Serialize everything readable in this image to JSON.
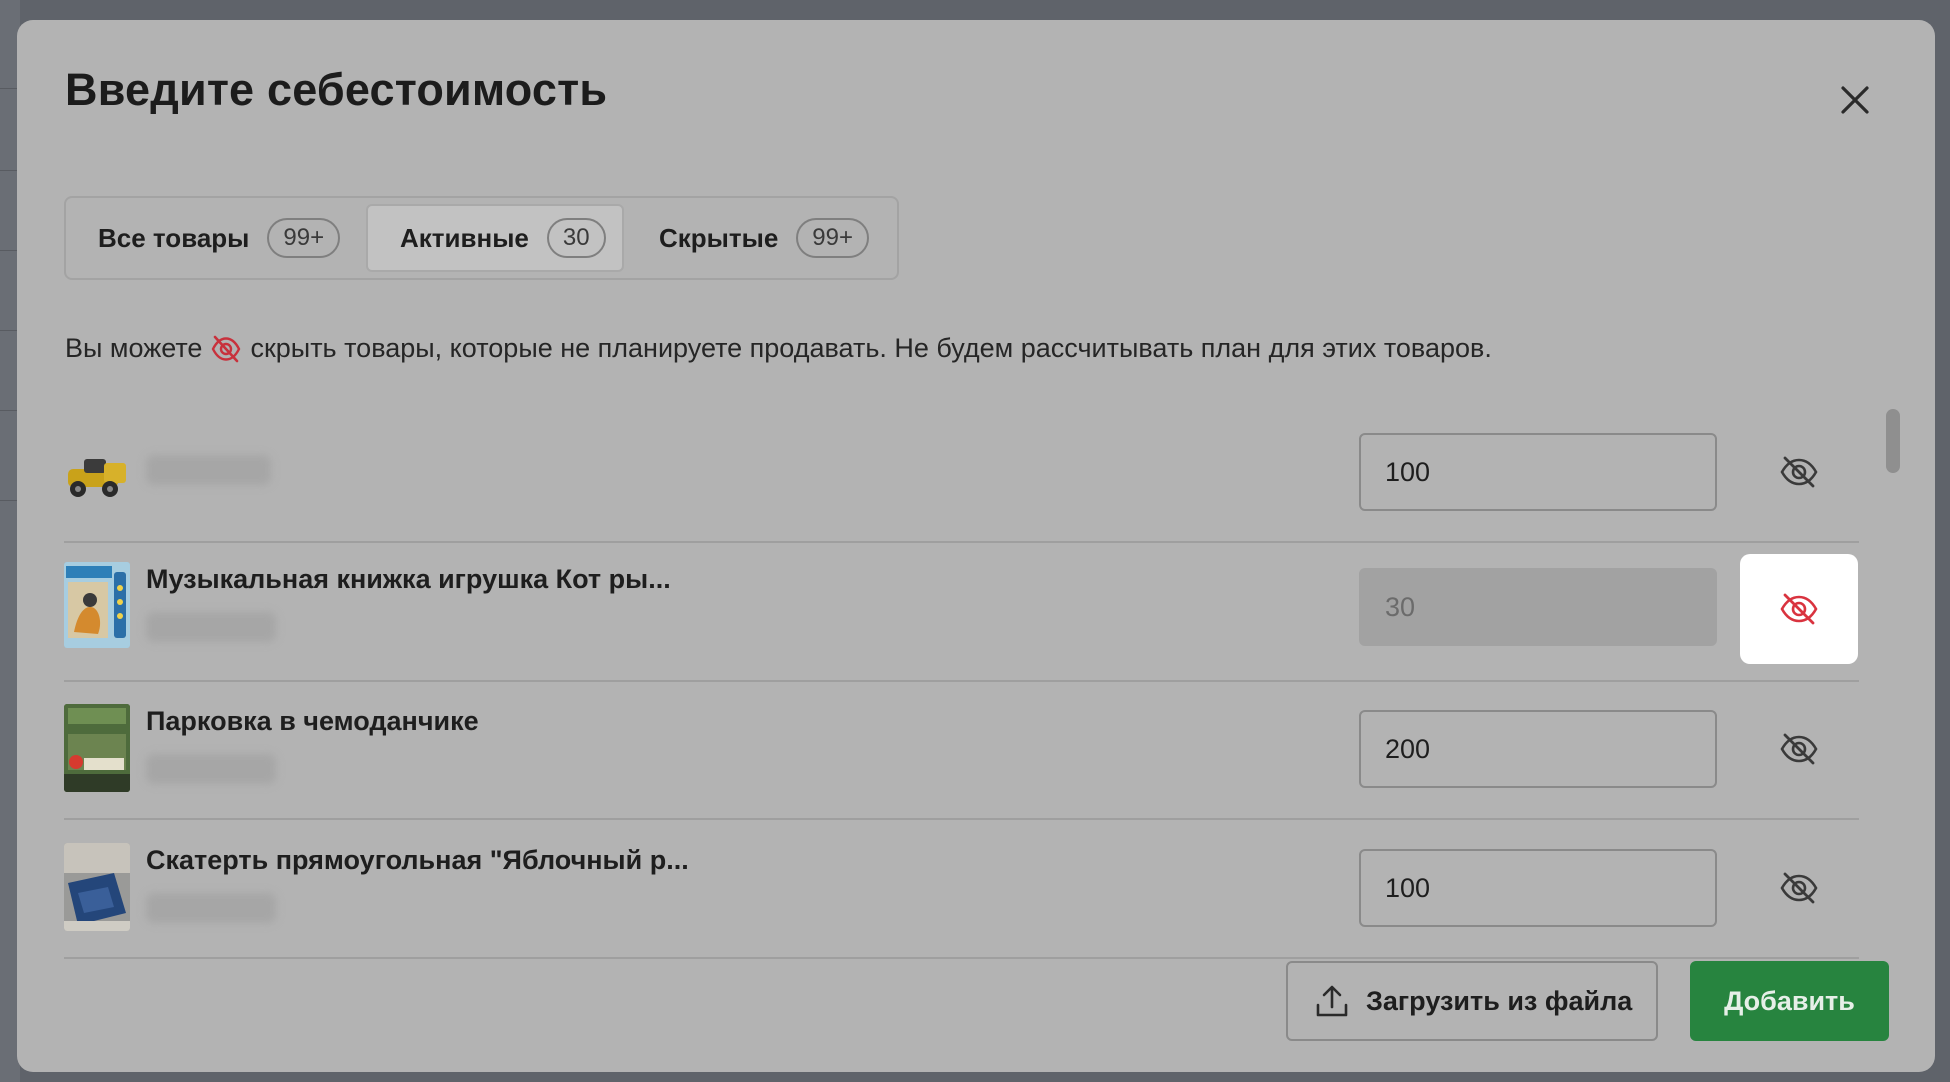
{
  "modal": {
    "title": "Введите себестоимость"
  },
  "tabs": [
    {
      "label": "Все товары",
      "count": "99+",
      "active": false
    },
    {
      "label": "Активные",
      "count": "30",
      "active": true
    },
    {
      "label": "Скрытые",
      "count": "99+",
      "active": false
    }
  ],
  "hint": {
    "before": "Вы можете",
    "after": "скрыть товары, которые не планируете продавать. Не будем рассчитывать план для этих товаров."
  },
  "products": [
    {
      "name": "",
      "cost": "100",
      "hidden": false,
      "icon": "eye-off-icon"
    },
    {
      "name": "Музыкальная книжка игрушка Кот ры...",
      "cost": "30",
      "hidden": true,
      "icon": "eye-off-icon"
    },
    {
      "name": "Парковка в чемоданчике",
      "cost": "200",
      "hidden": false,
      "icon": "eye-off-icon"
    },
    {
      "name": "Скатерть прямоугольная \"Яблочный р...",
      "cost": "100",
      "hidden": false,
      "icon": "eye-off-icon"
    }
  ],
  "footer": {
    "upload_label": "Загрузить из файла",
    "add_label": "Добавить"
  },
  "colors": {
    "overlay": "#5f636a",
    "modal_bg": "#b3b3b3",
    "accent_green": "#27843f",
    "hidden_red": "#d9333f"
  }
}
